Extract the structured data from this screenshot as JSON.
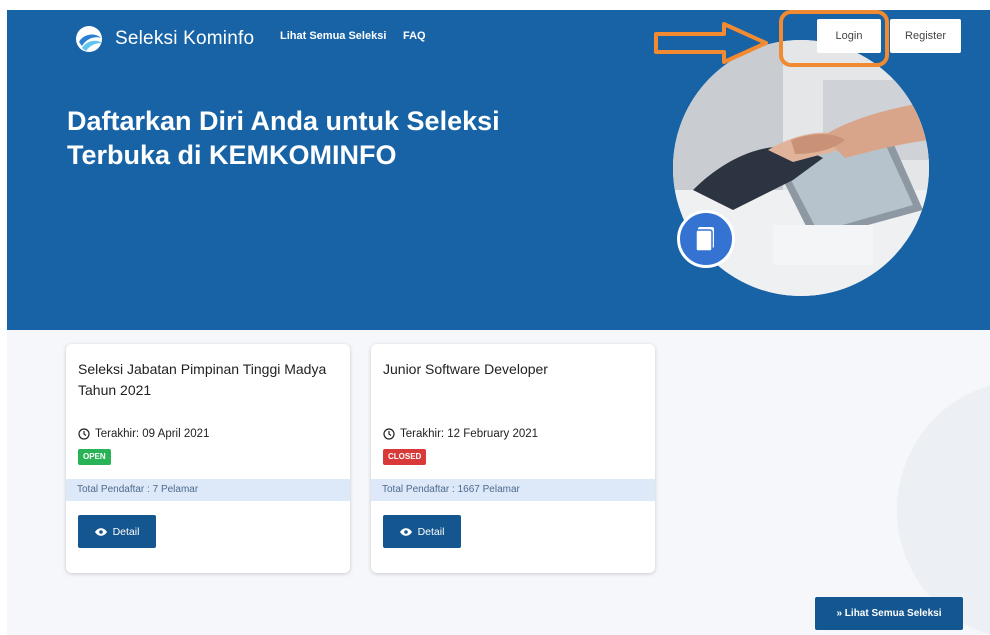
{
  "header": {
    "brand_name": "Seleksi Kominfo",
    "nav": {
      "all_selections": "Lihat Semua Seleksi",
      "faq": "FAQ"
    },
    "login_label": "Login",
    "register_label": "Register"
  },
  "hero": {
    "title": "Daftarkan Diri Anda untuk Seleksi Terbuka di KEMKOMINFO"
  },
  "cards": [
    {
      "title": "Seleksi Jabatan Pimpinan Tinggi Madya Tahun 2021",
      "deadline": "Terakhir: 09 April 2021",
      "status": "OPEN",
      "total_applicants": "Total Pendaftar : 7 Pelamar",
      "detail_label": "Detail"
    },
    {
      "title": "Junior Software Developer",
      "deadline": "Terakhir: 12 February 2021",
      "status": "CLOSED",
      "total_applicants": "Total Pendaftar : 1667 Pelamar",
      "detail_label": "Detail"
    }
  ],
  "view_all_label": "» Lihat Semua Seleksi",
  "icons": {
    "logo": "kominfo-logo-icon",
    "badge": "document-icon",
    "clock": "clock-icon",
    "eye": "eye-icon",
    "arrow": "annotation-arrow-icon"
  },
  "colors": {
    "primary": "#1763a6",
    "button": "#14568f",
    "open": "#2ab257",
    "closed": "#d83a3a",
    "annotation": "#f18a30"
  }
}
